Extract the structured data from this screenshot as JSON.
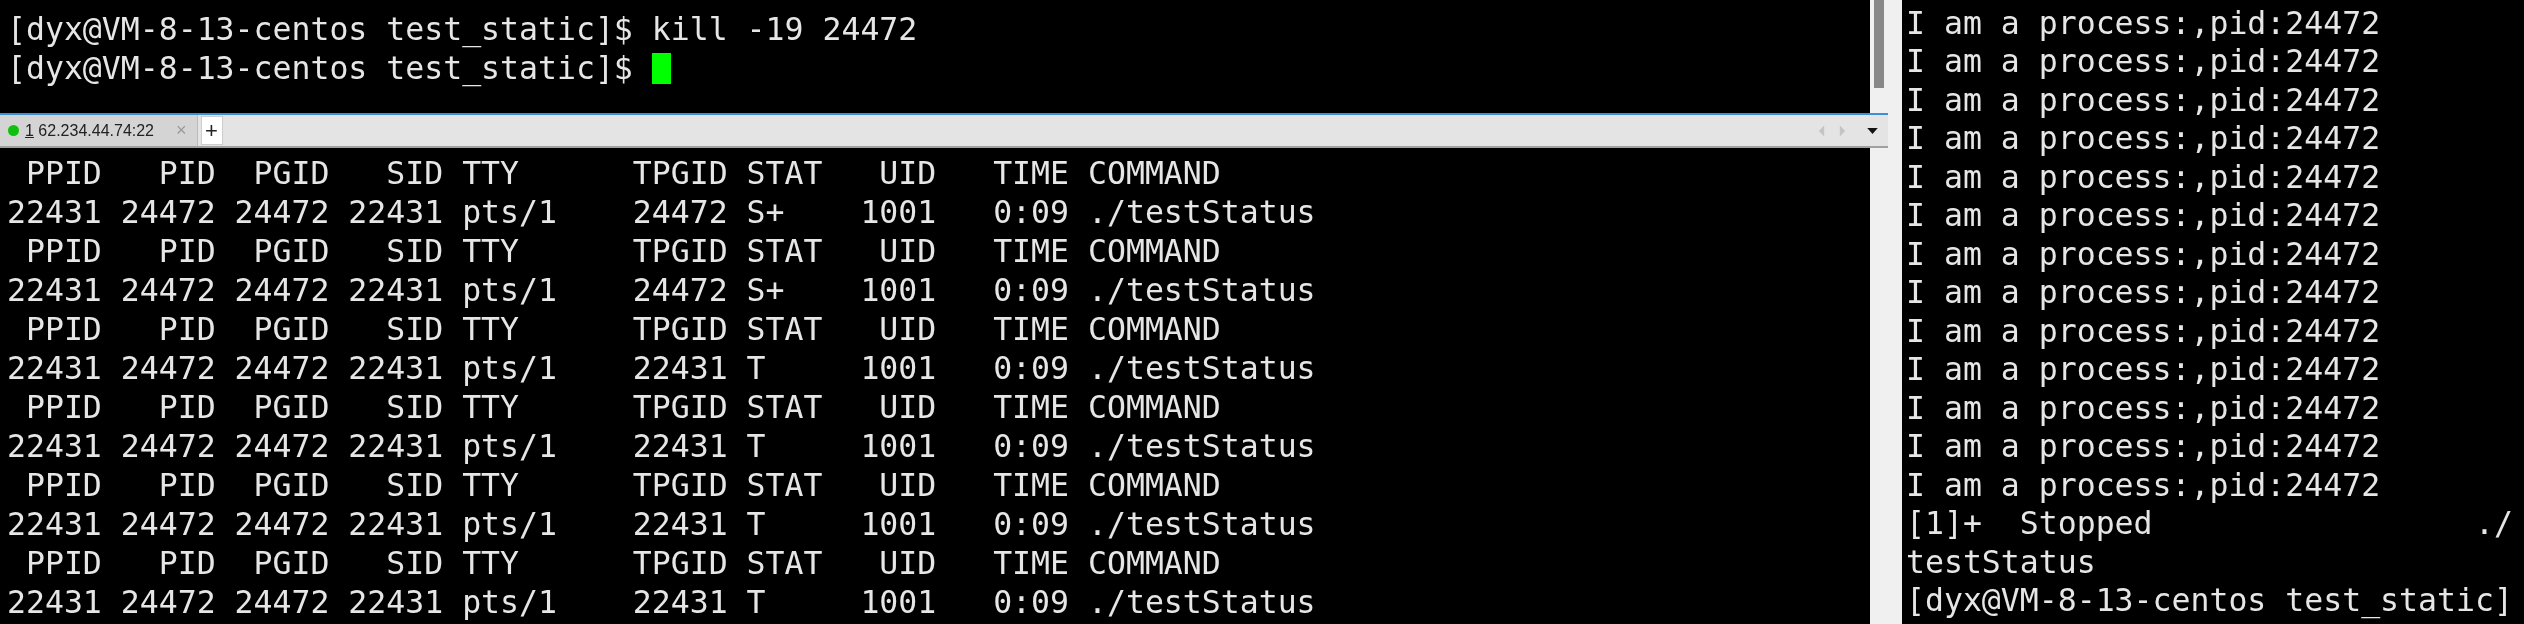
{
  "top_terminal": {
    "lines": [
      "[dyx@VM-8-13-centos test_static]$ kill -19 24472",
      "[dyx@VM-8-13-centos test_static]$ "
    ],
    "cursor": true
  },
  "tabs": [
    {
      "index": "1",
      "host": "62.234.44.74:22",
      "selected": true,
      "connected": true,
      "close": "×"
    }
  ],
  "new_tab": "+",
  "bottom_terminal": {
    "lines": [
      " PPID   PID  PGID   SID TTY      TPGID STAT   UID   TIME COMMAND",
      "22431 24472 24472 22431 pts/1    24472 S+    1001   0:09 ./testStatus",
      " PPID   PID  PGID   SID TTY      TPGID STAT   UID   TIME COMMAND",
      "22431 24472 24472 22431 pts/1    24472 S+    1001   0:09 ./testStatus",
      " PPID   PID  PGID   SID TTY      TPGID STAT   UID   TIME COMMAND",
      "22431 24472 24472 22431 pts/1    22431 T     1001   0:09 ./testStatus",
      " PPID   PID  PGID   SID TTY      TPGID STAT   UID   TIME COMMAND",
      "22431 24472 24472 22431 pts/1    22431 T     1001   0:09 ./testStatus",
      " PPID   PID  PGID   SID TTY      TPGID STAT   UID   TIME COMMAND",
      "22431 24472 24472 22431 pts/1    22431 T     1001   0:09 ./testStatus",
      " PPID   PID  PGID   SID TTY      TPGID STAT   UID   TIME COMMAND",
      "22431 24472 24472 22431 pts/1    22431 T     1001   0:09 ./testStatus"
    ]
  },
  "right_terminal": {
    "lines": [
      "I am a process:,pid:24472",
      "I am a process:,pid:24472",
      "I am a process:,pid:24472",
      "I am a process:,pid:24472",
      "I am a process:,pid:24472",
      "I am a process:,pid:24472",
      "I am a process:,pid:24472",
      "I am a process:,pid:24472",
      "I am a process:,pid:24472",
      "I am a process:,pid:24472",
      "I am a process:,pid:24472",
      "I am a process:,pid:24472",
      "I am a process:,pid:24472",
      "[1]+  Stopped                 ./",
      "testStatus",
      "[dyx@VM-8-13-centos test_static]"
    ]
  }
}
